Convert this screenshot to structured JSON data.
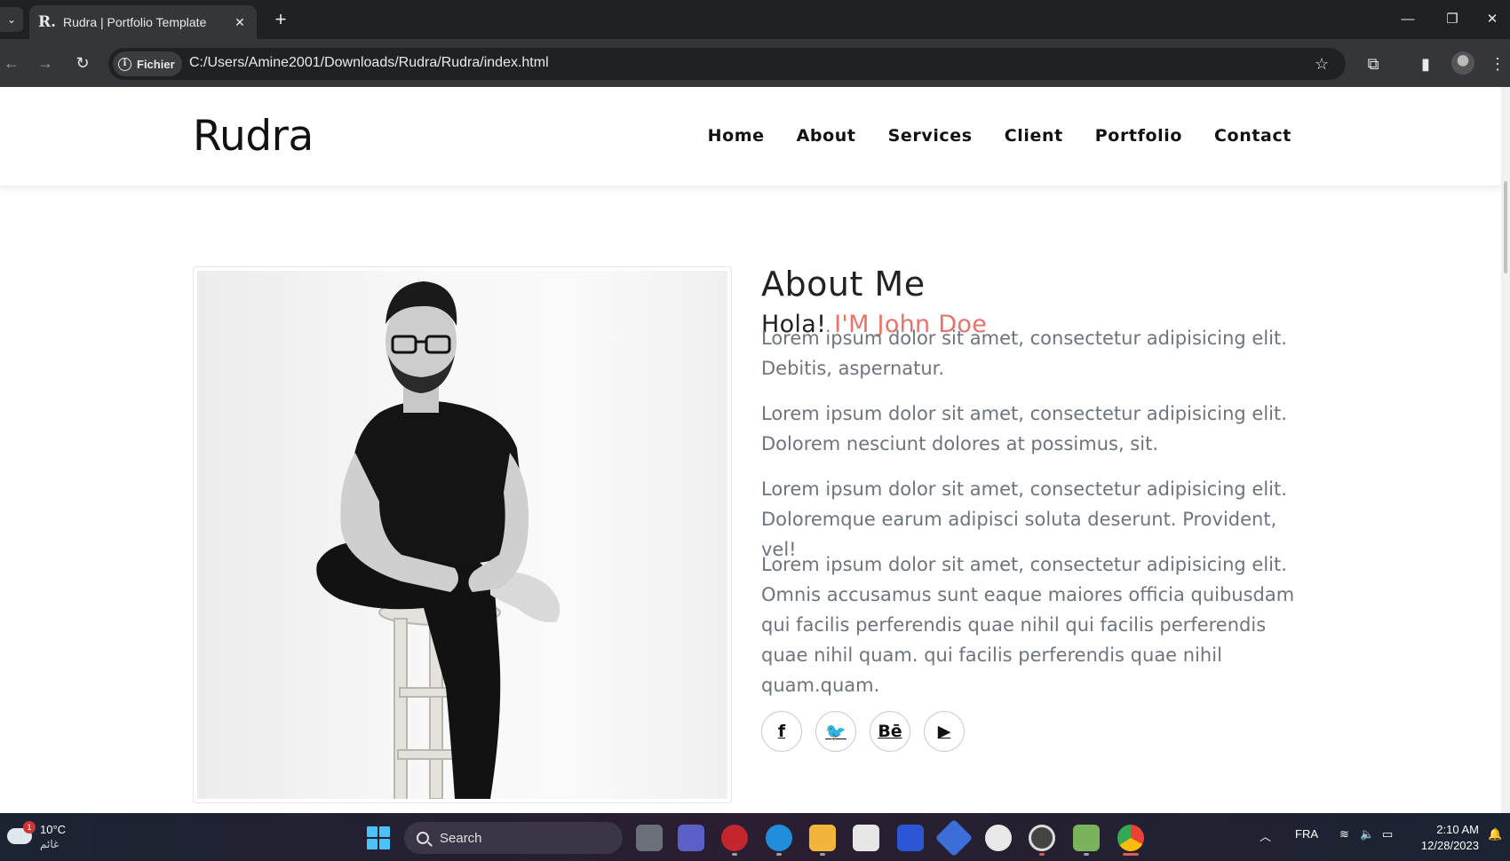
{
  "browser": {
    "tab_title": "Rudra | Portfolio Template",
    "favicon_letter": "R.",
    "address_chip": "Fichier",
    "url": "C:/Users/Amine2001/Downloads/Rudra/Rudra/index.html"
  },
  "site": {
    "brand": "Rudra",
    "nav": [
      "Home",
      "About",
      "Services",
      "Client",
      "Portfolio",
      "Contact"
    ]
  },
  "about": {
    "title": "About Me",
    "greeting": "Hola!",
    "name": "I'M John Doe",
    "paragraphs": [
      "Lorem ipsum dolor sit amet, consectetur adipisicing elit. Debitis, aspernatur.",
      "Lorem ipsum dolor sit amet, consectetur adipisicing elit. Dolorem nesciunt dolores at possimus, sit.",
      "Lorem ipsum dolor sit amet, consectetur adipisicing elit. Doloremque earum adipisci soluta deserunt. Provident, vel!",
      "Lorem ipsum dolor sit amet, consectetur adipisicing elit. Omnis accusamus sunt eaque maiores officia quibusdam qui facilis perferendis quae nihil qui facilis perferendis quae nihil quam. qui facilis perferendis quae nihil quam.quam."
    ],
    "accent_color": "#e8736b",
    "socials": [
      {
        "icon": "facebook-icon",
        "glyph": "f"
      },
      {
        "icon": "twitter-icon",
        "glyph": "🐦"
      },
      {
        "icon": "behance-icon",
        "glyph": "Bē"
      },
      {
        "icon": "youtube-icon",
        "glyph": "▶"
      }
    ]
  },
  "taskbar": {
    "weather_badge": "1",
    "temperature": "10°C",
    "condition": "غائم",
    "search_label": "Search",
    "language": "FRA",
    "time": "2:10 AM",
    "date": "12/28/2023"
  }
}
